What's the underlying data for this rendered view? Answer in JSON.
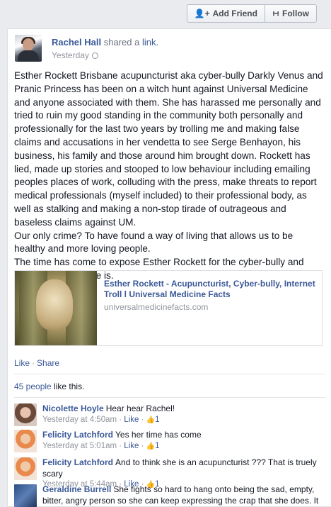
{
  "topbar": {
    "add_friend_label": "Add Friend",
    "follow_label": "Follow",
    "add_friend_icon": "add-friend-icon",
    "follow_icon": "follow-rss-icon"
  },
  "post": {
    "author": "Rachel Hall",
    "shared_text": "shared a",
    "link_word": "link.",
    "timestamp": "Yesterday",
    "paragraphs": [
      "Esther Rockett Brisbane acupuncturist aka cyber-bully Darkly Venus and Pranic Princess has been on a witch hunt against Universal Medicine and anyone associated with them. She has harassed me personally and tried to ruin my good standing in the community both personally and professionally for the last two years by trolling me and making false claims and accusations in her vendetta to see Serge Benhayon, his business, his family and those around him brought down. Rockett has lied, made up stories and stooped to low behaviour including emailing peoples places of work, colluding with the press, make threats to report medical professionals (myself included) to their professional body, as well as stalking and making a non-stop tirade of outrageous and baseless claims against UM.",
      "Our only crime? To have found a way of living that allows us to be healthy and more loving people.",
      "The time has come to expose Esther Rockett for the cyber-bully and internet troll that she is."
    ],
    "link_card": {
      "title": "Esther Rockett - Acupuncturist, Cyber-bully, Internet Troll l Universal Medicine Facts",
      "domain": "universalmedicinefacts.com"
    },
    "actions": {
      "like": "Like",
      "separator": "·",
      "share": "Share"
    },
    "likes_count_link": "45 people",
    "likes_suffix": " like this."
  },
  "comments": [
    {
      "name": "Nicolette Hoyle",
      "text": "Hear hear Rachel!",
      "time": "Yesterday at 4:50am",
      "like": "Like",
      "likes": "1"
    },
    {
      "name": "Felicity Latchford",
      "text": "Yes her time has come",
      "time": "Yesterday at 5:01am",
      "like": "Like",
      "likes": "1"
    },
    {
      "name": "Felicity Latchford",
      "text": "And to think she is an acupuncturist ??? That is truely scary",
      "time": "Yesterday at 5:44am",
      "like": "Like",
      "likes": "1"
    },
    {
      "name": "Geraldine Burrell",
      "text": "She fights so hard to hang onto being the sad, empty, bitter, angry person so she can keep expressing the crap that she does. It drives her insane that we know her in truth and more willingly than she will allow herself",
      "time": "",
      "like": "",
      "likes": ""
    }
  ],
  "meta_separator": " · ",
  "thumb_glyph": "👍"
}
